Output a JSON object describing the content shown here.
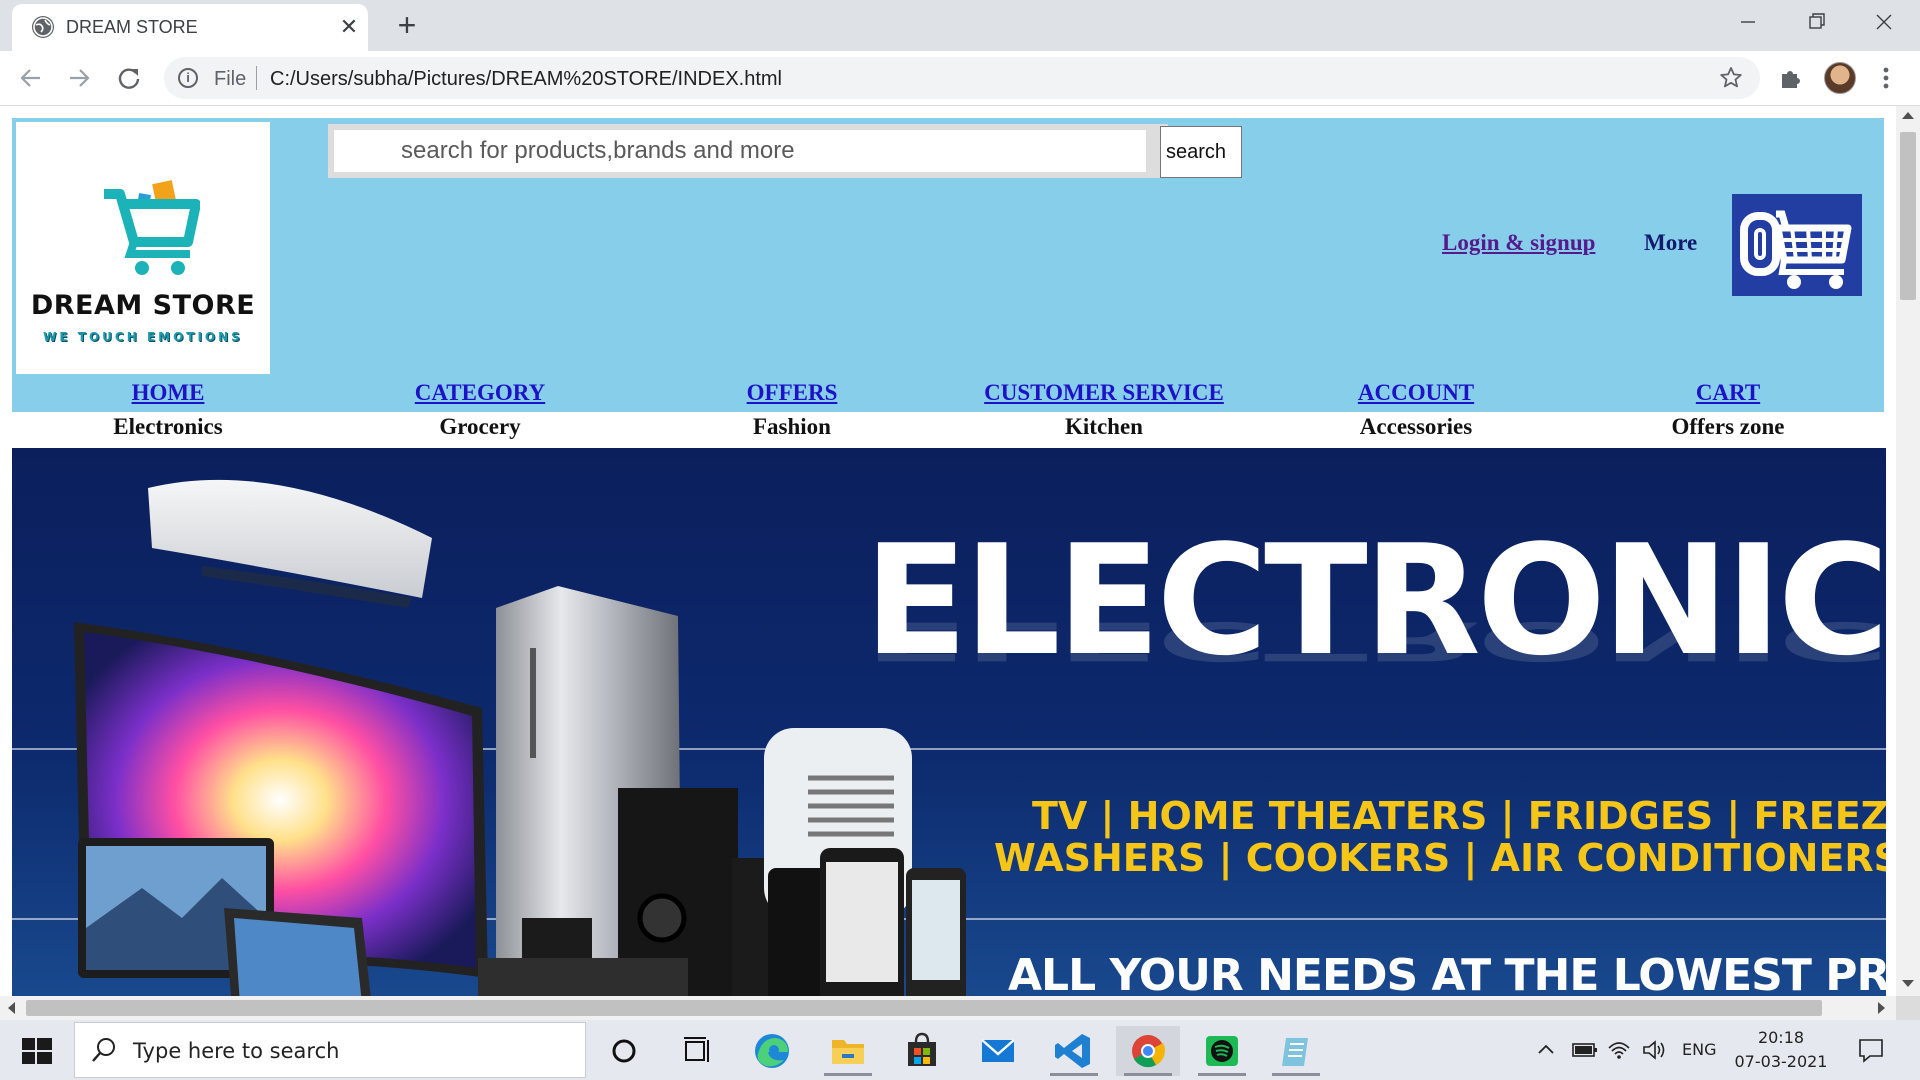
{
  "browser": {
    "tab_title": "DREAM STORE",
    "tab_close": "✕",
    "new_tab": "+",
    "scheme": "File",
    "url": "C:/Users/subha/Pictures/DREAM%20STORE/INDEX.html"
  },
  "site": {
    "logo_title": "DREAM STORE",
    "logo_tagline": "WE TOUCH EMOTIONS",
    "search_placeholder": "search for products,brands and more",
    "search_button": "search",
    "login_label": "Login & signup",
    "more_label": "More",
    "nav": [
      "HOME",
      "CATEGORY",
      "OFFERS",
      "CUSTOMER SERVICE",
      "ACCOUNT",
      "CART"
    ],
    "categories": [
      "Electronics",
      "Grocery",
      "Fashion",
      "Kitchen",
      "Accessories",
      "Offers zone"
    ]
  },
  "banner": {
    "title": "ELECTRONICS",
    "line_a": "TV | HOME THEATERS | FRIDGES | FREEZERS",
    "line_b": "WASHERS | COOKERS | AIR CONDITIONERS | ECT.",
    "tagline": "ALL YOUR NEEDS AT THE LOWEST PRICES!"
  },
  "taskbar": {
    "search_text": "Type here to search",
    "lang": "ENG",
    "time": "20:18",
    "date": "07-03-2021"
  },
  "colors": {
    "header_bg": "#87ceeb",
    "nav_link": "#1d12c8",
    "visited_link": "#551a8b",
    "banner_bg": "#0b1f5c",
    "banner_accent": "#f5c518",
    "cart_box": "#233ea2"
  }
}
